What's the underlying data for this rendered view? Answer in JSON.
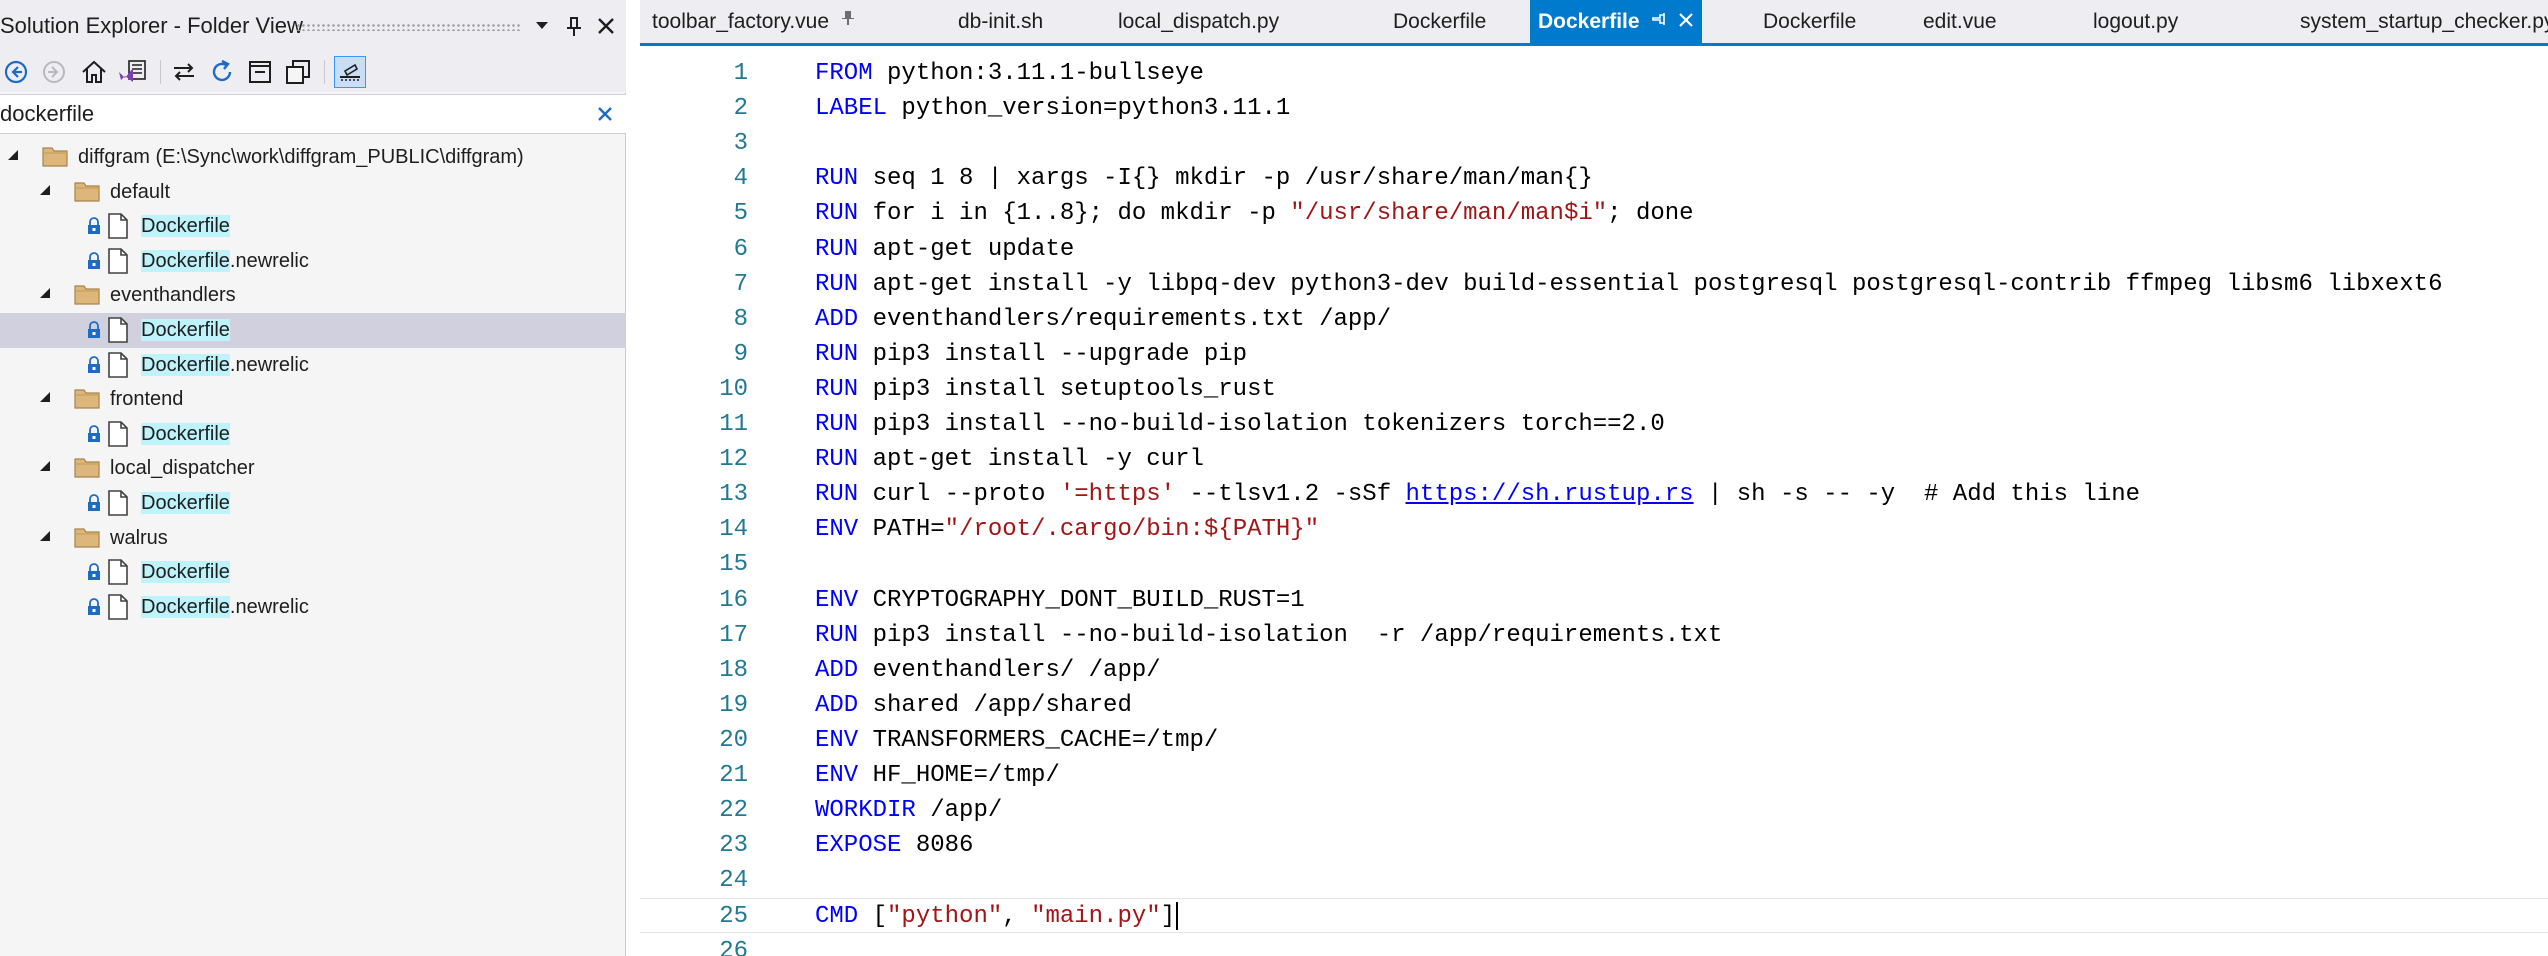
{
  "explorer": {
    "title": "Solution Explorer - Folder View",
    "search_value": "dockerfile",
    "tree": [
      {
        "kind": "root",
        "text": "diffgram (E:\\Sync\\work\\diffgram_PUBLIC\\diffgram)"
      },
      {
        "kind": "folder",
        "text": "default"
      },
      {
        "kind": "file",
        "hl": "Dockerfile",
        "rest": ""
      },
      {
        "kind": "file",
        "hl": "Dockerfile",
        "rest": ".newrelic"
      },
      {
        "kind": "folder",
        "text": "eventhandlers"
      },
      {
        "kind": "file",
        "hl": "Dockerfile",
        "rest": "",
        "selected": true
      },
      {
        "kind": "file",
        "hl": "Dockerfile",
        "rest": ".newrelic"
      },
      {
        "kind": "folder",
        "text": "frontend"
      },
      {
        "kind": "file",
        "hl": "Dockerfile",
        "rest": ""
      },
      {
        "kind": "folder",
        "text": "local_dispatcher"
      },
      {
        "kind": "file",
        "hl": "Dockerfile",
        "rest": ""
      },
      {
        "kind": "folder",
        "text": "walrus"
      },
      {
        "kind": "file",
        "hl": "Dockerfile",
        "rest": ""
      },
      {
        "kind": "file",
        "hl": "Dockerfile",
        "rest": ".newrelic"
      }
    ]
  },
  "tabs": [
    {
      "label": "toolbar_factory.vue",
      "pinned": true
    },
    {
      "label": "db-init.sh"
    },
    {
      "label": "local_dispatch.py"
    },
    {
      "label": "Dockerfile"
    },
    {
      "label": "Dockerfile",
      "active": true
    },
    {
      "label": "Dockerfile"
    },
    {
      "label": "edit.vue"
    },
    {
      "label": "logout.py"
    },
    {
      "label": "system_startup_checker.py"
    }
  ],
  "editor": {
    "current_line": 25,
    "lines": [
      [
        [
          "kw",
          "FROM"
        ],
        [
          "t",
          " python:3.11.1-bullseye"
        ]
      ],
      [
        [
          "kw",
          "LABEL"
        ],
        [
          "t",
          " python_version=python3.11.1"
        ]
      ],
      [],
      [
        [
          "kw",
          "RUN"
        ],
        [
          "t",
          " seq 1 8 | xargs -I{} mkdir -p /usr/share/man/man{}"
        ]
      ],
      [
        [
          "kw",
          "RUN"
        ],
        [
          "t",
          " for i in {1..8}; do mkdir -p "
        ],
        [
          "str",
          "\"/usr/share/man/man$i\""
        ],
        [
          "t",
          "; done"
        ]
      ],
      [
        [
          "kw",
          "RUN"
        ],
        [
          "t",
          " apt-get update"
        ]
      ],
      [
        [
          "kw",
          "RUN"
        ],
        [
          "t",
          " apt-get install -y libpq-dev python3-dev build-essential postgresql postgresql-contrib ffmpeg libsm6 libxext6"
        ]
      ],
      [
        [
          "kw",
          "ADD"
        ],
        [
          "t",
          " eventhandlers/requirements.txt /app/"
        ]
      ],
      [
        [
          "kw",
          "RUN"
        ],
        [
          "t",
          " pip3 install --upgrade pip"
        ]
      ],
      [
        [
          "kw",
          "RUN"
        ],
        [
          "t",
          " pip3 install setuptools_rust"
        ]
      ],
      [
        [
          "kw",
          "RUN"
        ],
        [
          "t",
          " pip3 install --no-build-isolation tokenizers torch==2.0"
        ]
      ],
      [
        [
          "kw",
          "RUN"
        ],
        [
          "t",
          " apt-get install -y curl"
        ]
      ],
      [
        [
          "kw",
          "RUN"
        ],
        [
          "t",
          " curl --proto "
        ],
        [
          "str",
          "'=https'"
        ],
        [
          "t",
          " --tlsv1.2 -sSf "
        ],
        [
          "url",
          "https://sh.rustup.rs"
        ],
        [
          "t",
          " | sh -s -- -y  # Add this line"
        ]
      ],
      [
        [
          "kw",
          "ENV"
        ],
        [
          "t",
          " PATH="
        ],
        [
          "str",
          "\"/root/.cargo/bin:${PATH}\""
        ]
      ],
      [],
      [
        [
          "kw",
          "ENV"
        ],
        [
          "t",
          " CRYPTOGRAPHY_DONT_BUILD_RUST=1"
        ]
      ],
      [
        [
          "kw",
          "RUN"
        ],
        [
          "t",
          " pip3 install --no-build-isolation  -r /app/requirements.txt"
        ]
      ],
      [
        [
          "kw",
          "ADD"
        ],
        [
          "t",
          " eventhandlers/ /app/"
        ]
      ],
      [
        [
          "kw",
          "ADD"
        ],
        [
          "t",
          " shared /app/shared"
        ]
      ],
      [
        [
          "kw",
          "ENV"
        ],
        [
          "t",
          " TRANSFORMERS_CACHE=/tmp/"
        ]
      ],
      [
        [
          "kw",
          "ENV"
        ],
        [
          "t",
          " HF_HOME=/tmp/"
        ]
      ],
      [
        [
          "kw",
          "WORKDIR"
        ],
        [
          "t",
          " /app/"
        ]
      ],
      [
        [
          "kw",
          "EXPOSE"
        ],
        [
          "t",
          " 8086"
        ]
      ],
      [],
      [
        [
          "kw",
          "CMD"
        ],
        [
          "t",
          " ["
        ],
        [
          "str",
          "\"python\""
        ],
        [
          "t",
          ", "
        ],
        [
          "str",
          "\"main.py\""
        ],
        [
          "t",
          "]"
        ]
      ],
      []
    ]
  },
  "colors": {
    "accent": "#007acc",
    "keyword": "#0000ff",
    "string": "#a31515",
    "line_number": "#237893",
    "match_highlight": "#bff3fb",
    "selected_row": "#d0d0de"
  },
  "icons": [
    "back-icon",
    "forward-icon",
    "home-icon",
    "vs-solution-icon",
    "sync-icon",
    "refresh-icon",
    "collapse-all-icon",
    "show-all-files-icon",
    "properties-icon",
    "dropdown-icon",
    "pin-icon",
    "close-icon",
    "folder-icon",
    "lock-icon",
    "file-icon",
    "expand-arrow-icon"
  ]
}
